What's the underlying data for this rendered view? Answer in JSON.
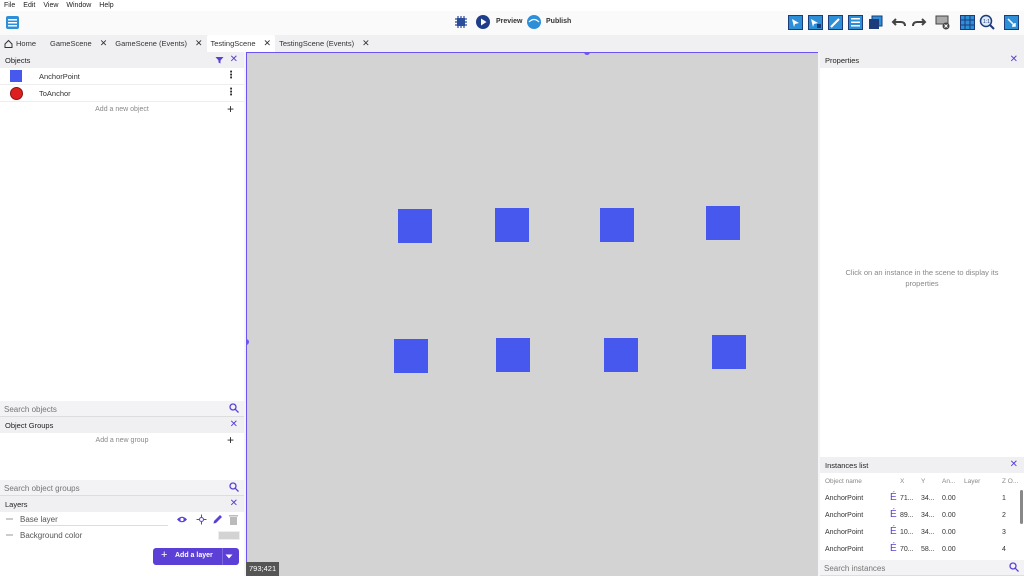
{
  "menu": [
    "File",
    "Edit",
    "View",
    "Window",
    "Help"
  ],
  "toolbar": {
    "preview_label": "Preview",
    "publish_label": "Publish"
  },
  "tabs": [
    {
      "label": "Home",
      "closable": false,
      "active": false
    },
    {
      "label": "GameScene",
      "closable": true,
      "active": false
    },
    {
      "label": "GameScene (Events)",
      "closable": true,
      "active": false
    },
    {
      "label": "TestingScene",
      "closable": true,
      "active": true
    },
    {
      "label": "TestingScene (Events)",
      "closable": true,
      "active": false
    }
  ],
  "objects_panel": {
    "title": "Objects",
    "items": [
      {
        "label": "AnchorPoint",
        "icon": "blue-square-icon"
      },
      {
        "label": "ToAnchor",
        "icon": "red-circle-icon"
      }
    ],
    "add_label": "Add a new object",
    "search_placeholder": "Search objects"
  },
  "groups_panel": {
    "title": "Object Groups",
    "add_label": "Add a new group",
    "search_placeholder": "Search object groups"
  },
  "layers_panel": {
    "title": "Layers",
    "base_layer": "Base layer",
    "background_label": "Background color",
    "add_layer_label": "Add a layer"
  },
  "canvas": {
    "coords": "793;421"
  },
  "properties_panel": {
    "title": "Properties",
    "message": "Click on an instance in the scene to display its properties"
  },
  "instances_panel": {
    "title": "Instances list",
    "columns": [
      "Object name",
      "X",
      "Y",
      "An...",
      "Layer",
      "Z O..."
    ],
    "rows": [
      {
        "name": "AnchorPoint",
        "x": "71...",
        "y": "34...",
        "angle": "0.00",
        "layer": "",
        "z": "1"
      },
      {
        "name": "AnchorPoint",
        "x": "89...",
        "y": "34...",
        "angle": "0.00",
        "layer": "",
        "z": "2"
      },
      {
        "name": "AnchorPoint",
        "x": "10...",
        "y": "34...",
        "angle": "0.00",
        "layer": "",
        "z": "3"
      },
      {
        "name": "AnchorPoint",
        "x": "70...",
        "y": "58...",
        "angle": "0.00",
        "layer": "",
        "z": "4"
      }
    ],
    "search_placeholder": "Search instances"
  },
  "colors": {
    "accent": "#5b3fd6",
    "instance_blue": "#4758ee",
    "canvas_bg": "#d3d3d3"
  }
}
